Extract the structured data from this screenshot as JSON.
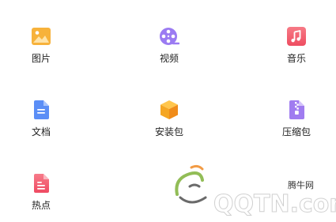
{
  "categories": [
    {
      "label": "图片",
      "icon": "image-icon",
      "color": "#f5a623"
    },
    {
      "label": "视频",
      "icon": "video-reel-icon",
      "color": "#9b7bf2"
    },
    {
      "label": "音乐",
      "icon": "music-icon",
      "color": "#f25c6e"
    },
    {
      "label": "文档",
      "icon": "document-icon",
      "color": "#5b8ef6"
    },
    {
      "label": "安装包",
      "icon": "package-box-icon",
      "color": "#f5a623"
    },
    {
      "label": "压缩包",
      "icon": "zip-archive-icon",
      "color": "#a07cf0"
    },
    {
      "label": "热点",
      "icon": "hotspot-doc-icon",
      "color": "#f2546a"
    }
  ],
  "watermark": {
    "brand_cn": "腾牛网",
    "brand_en": "QQTN.com"
  }
}
